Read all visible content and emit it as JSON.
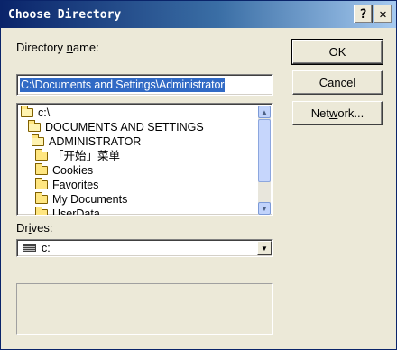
{
  "window": {
    "title": "Choose Directory",
    "help_glyph": "?",
    "close_glyph": "✕"
  },
  "directory_name": {
    "label_before": "Directory ",
    "label_key": "n",
    "label_after": "ame:",
    "value": "C:\\Documents and Settings\\Administrator"
  },
  "tree": {
    "items": [
      {
        "label": "c:\\",
        "icon": "open-folder-icon"
      },
      {
        "label": "DOCUMENTS AND SETTINGS",
        "icon": "open-folder-icon"
      },
      {
        "label": "ADMINISTRATOR",
        "icon": "open-folder-icon"
      },
      {
        "label": "「开始」菜单",
        "icon": "folder-icon"
      },
      {
        "label": "Cookies",
        "icon": "folder-icon"
      },
      {
        "label": "Favorites",
        "icon": "folder-icon"
      },
      {
        "label": "My Documents",
        "icon": "folder-icon"
      },
      {
        "label": "UserData",
        "icon": "folder-icon"
      }
    ]
  },
  "drives": {
    "label_before": "Dr",
    "label_key": "i",
    "label_after": "ves:",
    "selected": "c:",
    "icon": "hard-drive-icon"
  },
  "buttons": {
    "ok": "OK",
    "cancel": "Cancel",
    "network_before": "Net",
    "network_key": "w",
    "network_after": "ork..."
  }
}
